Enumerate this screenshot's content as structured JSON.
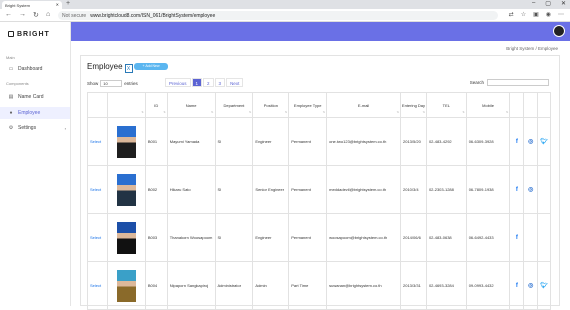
{
  "browser": {
    "tab_title": "Bright System",
    "url_prefix": "Not secure",
    "url": "www.brightcloud8.com/ISN_061/BrightSystem/employee"
  },
  "brand": "BRIGHT",
  "sidebar": {
    "main_label": "Main",
    "components_label": "Components",
    "items": [
      {
        "label": "Dashboard",
        "icon": "monitor-icon"
      },
      {
        "label": "Name Card",
        "icon": "card-icon"
      },
      {
        "label": "Employee",
        "icon": "user-icon"
      },
      {
        "label": "Settings",
        "icon": "gear-icon"
      }
    ]
  },
  "breadcrumb": "Bright System / Employee",
  "page": {
    "title": "Employee",
    "add_label": "Add New"
  },
  "controls": {
    "show_label": "Show",
    "show_value": "10",
    "entries_label": "entries",
    "search_label": "Search"
  },
  "pager": {
    "prev": "Previous",
    "pages": [
      "1",
      "2",
      "3"
    ],
    "next": "Next"
  },
  "table": {
    "headers": [
      "",
      "",
      "ID",
      "Name",
      "Department",
      "Position",
      "Employee Type",
      "E-mail",
      "Entering Day",
      "TEL",
      "Mobile",
      "",
      "",
      ""
    ],
    "rows": [
      {
        "action": "Select",
        "id": "B001",
        "name": "Mayumi Yamada",
        "dept": "SI",
        "position": "Engineer",
        "type": "Permanent",
        "email": "one.two123@brightsystem.co.th",
        "day": "2013/5/20",
        "tel": "02-483-4292",
        "mobile": "06-6309-3928"
      },
      {
        "action": "Select",
        "id": "B002",
        "name": "Hikaru Sato",
        "dept": "SI",
        "position": "Senior Engineer",
        "type": "Permanent",
        "email": "meddadevil@brightsystem.co.th",
        "day": "2010/3/4",
        "tel": "02-2303-1288",
        "mobile": "06-7809-1938"
      },
      {
        "action": "Select",
        "id": "B003",
        "name": "Thanakorn Woosapoom",
        "dept": "SI",
        "position": "Engineer",
        "type": "Permanent",
        "email": "woosapoom@brightsystem.co.th",
        "day": "2014/06/6",
        "tel": "02-483-0638",
        "mobile": "06-6492-4433"
      },
      {
        "action": "Select",
        "id": "B004",
        "name": "Nipaporn Sangkapiroj",
        "dept": "Administrator",
        "position": "Admin",
        "type": "Part Time",
        "email": "suwanan@brightsystem.co.th",
        "day": "2013/3/31",
        "tel": "02-4693-3284",
        "mobile": "09-0993-4432"
      }
    ]
  },
  "colors": {
    "accent": "#6a70e6",
    "link": "#1a73e8"
  }
}
